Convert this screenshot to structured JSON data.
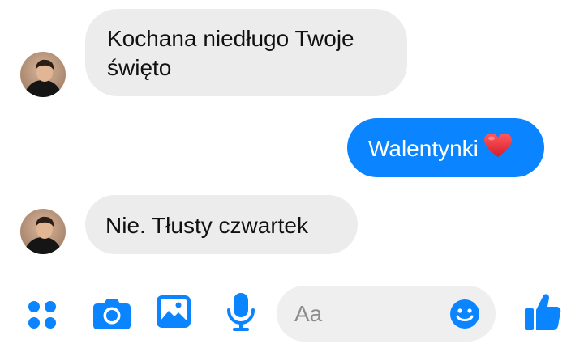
{
  "colors": {
    "accent": "#0a84ff",
    "incoming_bubble": "#ececec",
    "input_background": "#efefef",
    "placeholder": "#8c8c8c",
    "heart": "#e0242c"
  },
  "messages": [
    {
      "direction": "incoming",
      "lines": [
        "Kochana niedługo Twoje",
        "święto"
      ]
    },
    {
      "direction": "outgoing",
      "text": "Walentynki",
      "emoji": "red-heart-icon"
    },
    {
      "direction": "incoming",
      "text": "Nie. Tłusty czwartek"
    }
  ],
  "composer": {
    "placeholder": "Aa",
    "value": "",
    "icons": [
      "apps-icon",
      "camera-icon",
      "image-icon",
      "microphone-icon",
      "emoji-icon",
      "thumbs-up-icon"
    ]
  }
}
